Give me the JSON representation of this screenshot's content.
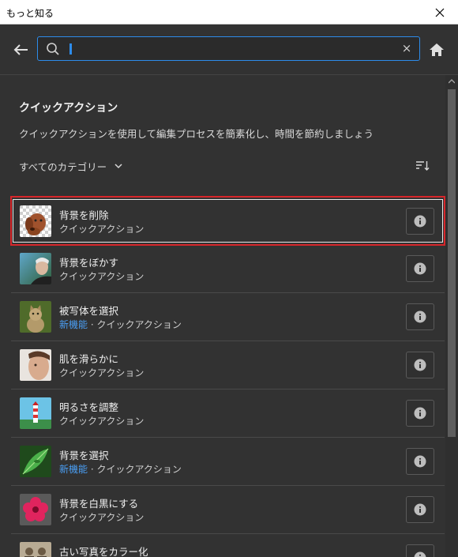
{
  "window": {
    "title": "もっと知る",
    "close_glyph": "✕"
  },
  "search": {
    "value": "",
    "placeholder": "",
    "clear_glyph": "×"
  },
  "panel": {
    "heading": "クイックアクション",
    "description": "クイックアクションを使用して編集プロセスを簡素化し、時間を節約しましょう",
    "category_label": "すべてのカテゴリー"
  },
  "items": [
    {
      "name": "背景を削除",
      "new": "",
      "separator": "",
      "type": "クイックアクション",
      "icon": "dog-transparent-thumbnail",
      "selected": true
    },
    {
      "name": "背景をぼかす",
      "new": "",
      "separator": "",
      "type": "クイックアクション",
      "icon": "portrait-blur-thumbnail",
      "selected": false
    },
    {
      "name": "被写体を選択",
      "new": "新機能",
      "separator": " · ",
      "type": "クイックアクション",
      "icon": "cat-thumbnail",
      "selected": false
    },
    {
      "name": "肌を滑らかに",
      "new": "",
      "separator": "",
      "type": "クイックアクション",
      "icon": "face-thumbnail",
      "selected": false
    },
    {
      "name": "明るさを調整",
      "new": "",
      "separator": "",
      "type": "クイックアクション",
      "icon": "lighthouse-thumbnail",
      "selected": false
    },
    {
      "name": "背景を選択",
      "new": "新機能",
      "separator": " · ",
      "type": "クイックアクション",
      "icon": "leaf-thumbnail",
      "selected": false
    },
    {
      "name": "背景を白黒にする",
      "new": "",
      "separator": "",
      "type": "クイックアクション",
      "icon": "flower-thumbnail",
      "selected": false
    },
    {
      "name": "古い写真をカラー化",
      "new": "",
      "separator": "",
      "type": "クイックアクション",
      "icon": "old-photo-thumbnail",
      "selected": false
    }
  ],
  "colors": {
    "accent": "#2d8ceb",
    "selected_outline": "#d7262a",
    "new_feature": "#4a9ff5"
  }
}
